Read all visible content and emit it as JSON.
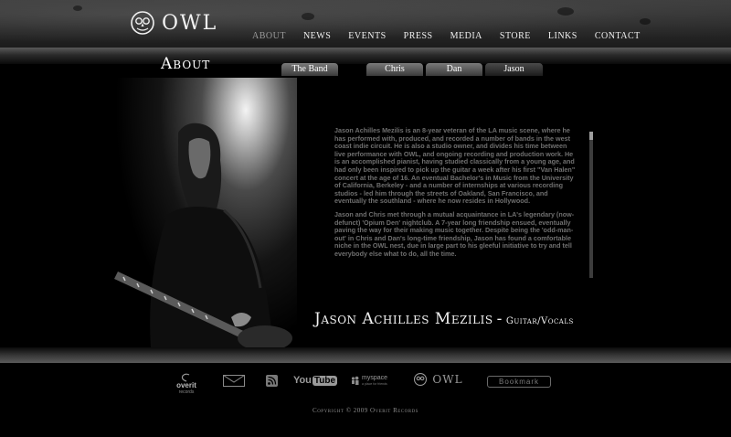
{
  "brand": {
    "name": "OWL"
  },
  "nav": [
    {
      "label": "ABOUT",
      "active": true
    },
    {
      "label": "NEWS"
    },
    {
      "label": "EVENTS"
    },
    {
      "label": "PRESS"
    },
    {
      "label": "MEDIA"
    },
    {
      "label": "STORE"
    },
    {
      "label": "LINKS"
    },
    {
      "label": "CONTACT"
    }
  ],
  "page": {
    "title": "About"
  },
  "tabs": {
    "band": "The Band",
    "members": [
      {
        "label": "Chris"
      },
      {
        "label": "Dan"
      },
      {
        "label": "Jason",
        "active": true
      }
    ]
  },
  "bio": {
    "p1": "Jason Achilles Mezilis is an 8-year veteran of the LA music scene, where he has performed with, produced, and recorded a number of bands in the west coast indie circuit. He is also a studio owner, and divides his time between live performance with OWL, and ongoing recording and production work. He is an accomplished pianist, having studied classically from a young age, and had only been inspired to pick up the guitar a week after his first \"Van Halen\" concert at the age of 16. An eventual Bachelor's in Music from the University of California, Berkeley - and a number of internships at various recording studios - led him through the streets of Oakland, San Francisco, and eventually the southland - where he now resides in Hollywood.",
    "p2": "Jason and Chris met through a mutual acquaintance in LA's legendary (now-defunct) 'Opium Den' nightclub. A 7-year long friendship ensued, eventually paving the way for their making music together. Despite being the 'odd-man-out' in Chris and Dan's long-time friendship, Jason has found a comfortable niche in the OWL nest, due in large part to his gleeful initiative to try and tell everybody else what to do, all the time."
  },
  "member": {
    "name": "Jason Achilles Mezilis",
    "dash": "-",
    "role": "Guitar/Vocals"
  },
  "footer": {
    "overit_label": "overit",
    "overit_sub": "records",
    "youtube_label": "You",
    "youtube_tube": "Tube",
    "myspace_label": "myspace",
    "myspace_sub": "a place for friends",
    "owl_label": "OWL",
    "bookmark_label": "Bookmark",
    "copyright": "Copyright © 2009 Overit Records"
  },
  "icons": {
    "logo": "owl-face-icon",
    "email": "envelope-icon",
    "rss": "rss-icon",
    "myspace": "myspace-people-icon"
  }
}
